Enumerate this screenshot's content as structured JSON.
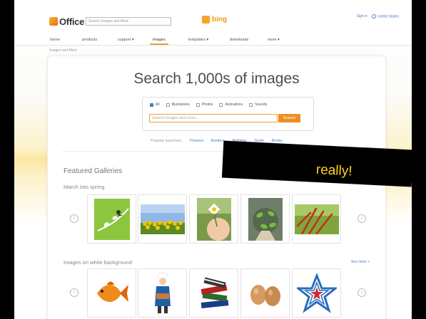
{
  "header": {
    "logo_text": "Office",
    "search_placeholder": "Search Images and More",
    "bing_label": "bing",
    "signin_label": "Sign in",
    "region_label": "United States"
  },
  "nav": {
    "items": [
      "home",
      "products",
      "support ▾",
      "images",
      "templates ▾",
      "downloads",
      "more ▾"
    ],
    "active_index": 3
  },
  "breadcrumb": "Images and More",
  "hero": {
    "title": "Search 1,000s of images",
    "filters": [
      {
        "label": "All",
        "checked": true
      },
      {
        "label": "Illustrations",
        "checked": false
      },
      {
        "label": "Photos",
        "checked": false
      },
      {
        "label": "Animations",
        "checked": false
      },
      {
        "label": "Sounds",
        "checked": false
      }
    ],
    "search_placeholder": "Search images and more...",
    "search_button": "Search"
  },
  "popular": {
    "label": "Popular searches:",
    "links": [
      "Flowers",
      "Borders",
      "Birthday",
      "Smile",
      "Books"
    ]
  },
  "featured": {
    "title": "Featured Galleries",
    "gallery1": {
      "title": "March into spring",
      "thumbs": [
        "bird-on-branch",
        "tulip-field",
        "daisy-in-hands",
        "plant-sprouts",
        "red-stems"
      ]
    },
    "gallery2": {
      "title": "Images on white background",
      "see_more": "See more >",
      "thumbs": [
        "goldfish",
        "girl-with-cake",
        "stack-of-books",
        "eggs",
        "star-badge"
      ]
    }
  },
  "overlay": {
    "caption": "really!",
    "color": "#ffd21f"
  }
}
